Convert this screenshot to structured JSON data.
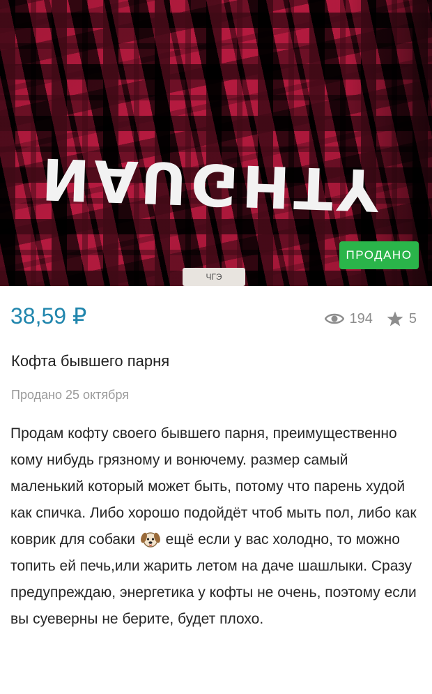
{
  "listing": {
    "photo": {
      "print_text": "NAUGHTY",
      "collar_tag_text": "ЧГЭ",
      "badge": "ПРОДАНО"
    },
    "price": "38,59 ₽",
    "views_icon": "eye-icon",
    "views_count": "194",
    "favorites_icon": "star-icon",
    "favorites_count": "5",
    "title": "Кофта бывшего парня",
    "sold_date": "Продано 25 октября",
    "description_part1": "Продам кофту своего бывшего парня, преимущественно кому нибудь грязному и вонючему. размер самый маленький который может быть, потому что парень худой как спичка. Либо хорошо подойдёт чтоб мыть пол, либо как коврик для собаки",
    "description_emoji": "dog-face-icon",
    "description_part2": "ещё если у вас холодно, то можно топить ей печь,или жарить летом на даче шашлыки. Сразу предупреждаю, энергетика у кофты не очень, поэтому если вы суеверны не берите, будет плохо."
  },
  "colors": {
    "price": "#2186ad",
    "badge": "#2ab54a",
    "muted": "#8d8d8d",
    "text": "#262626"
  }
}
